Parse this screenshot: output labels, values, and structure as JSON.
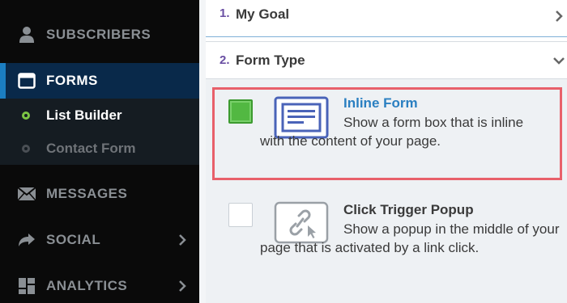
{
  "sidebar": {
    "items": [
      {
        "label": "SUBSCRIBERS",
        "icon": "user-icon"
      },
      {
        "label": "FORMS",
        "icon": "window-icon",
        "active": true
      },
      {
        "label": "MESSAGES",
        "icon": "envelope-icon"
      },
      {
        "label": "SOCIAL",
        "icon": "share-arrow-icon"
      },
      {
        "label": "ANALYTICS",
        "icon": "grid-icon"
      }
    ],
    "forms_subitems": [
      {
        "label": "List Builder",
        "active": true
      },
      {
        "label": "Contact Form",
        "active": false
      }
    ]
  },
  "steps": [
    {
      "number": "1.",
      "title": "My Goal",
      "chevron": "chevron-right-icon"
    },
    {
      "number": "2.",
      "title": "Form Type",
      "chevron": "chevron-down-icon"
    }
  ],
  "form_types": [
    {
      "title": "Inline Form",
      "description": "Show a form box that is inline with the content of your page.",
      "selected": true
    },
    {
      "title": "Click Trigger Popup",
      "description": "Show a popup in the middle of your page that is activated by a link click.",
      "selected": false
    }
  ],
  "colors": {
    "sidebar_bg": "#0a0a0a",
    "active_nav_bg": "#09294a",
    "accent_blue": "#1b7ec2",
    "selected_green": "#52b842",
    "highlight_red": "#e8606a",
    "step_number": "#6a4fa3"
  }
}
